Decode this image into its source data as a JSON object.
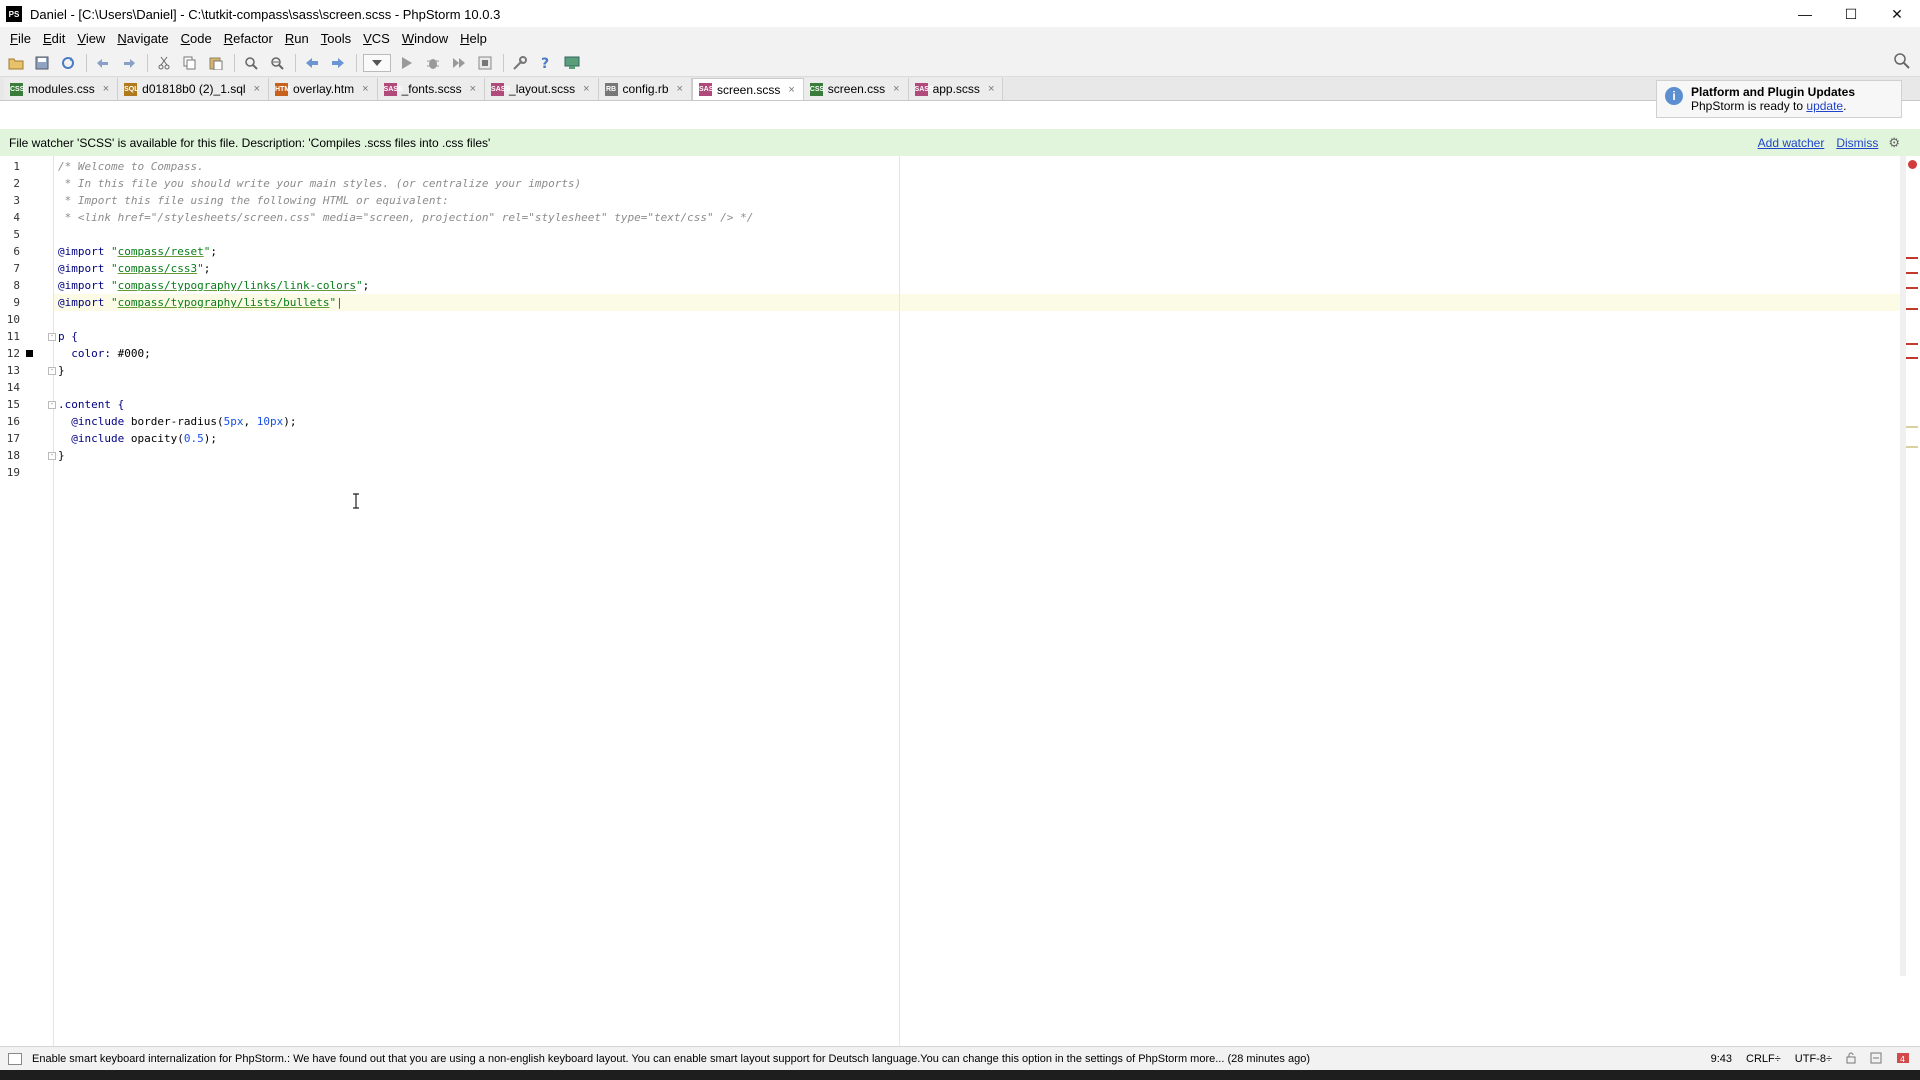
{
  "window": {
    "title": "Daniel - [C:\\Users\\Daniel] - C:\\tutkit-compass\\sass\\screen.scss - PhpStorm 10.0.3",
    "app_icon_text": "PS",
    "minimize_symbol": "—",
    "maximize_symbol": "☐",
    "close_symbol": "✕"
  },
  "menu": [
    {
      "label": "File",
      "mnemonic": "F",
      "rest": "ile"
    },
    {
      "label": "Edit",
      "mnemonic": "E",
      "rest": "dit"
    },
    {
      "label": "View",
      "mnemonic": "V",
      "rest": "iew"
    },
    {
      "label": "Navigate",
      "mnemonic": "N",
      "rest": "avigate"
    },
    {
      "label": "Code",
      "mnemonic": "C",
      "rest": "ode"
    },
    {
      "label": "Refactor",
      "mnemonic": "R",
      "rest": "efactor"
    },
    {
      "label": "Run",
      "mnemonic": "R",
      "rest": "un"
    },
    {
      "label": "Tools",
      "mnemonic": "T",
      "rest": "ools"
    },
    {
      "label": "VCS",
      "mnemonic": "V",
      "rest": "CS"
    },
    {
      "label": "Window",
      "mnemonic": "W",
      "rest": "indow"
    },
    {
      "label": "Help",
      "mnemonic": "H",
      "rest": "elp"
    }
  ],
  "toolbar": {
    "icons": [
      "open-folder-icon",
      "save-all-icon",
      "synchronize-icon",
      "undo-icon",
      "redo-icon",
      "cut-icon",
      "copy-icon",
      "paste-icon",
      "find-icon",
      "replace-icon",
      "back-icon",
      "forward-icon",
      "run-config-dropdown",
      "run-icon",
      "debug-icon",
      "coverage-icon",
      "stop-icon",
      "settings-icon",
      "help-icon",
      "ftp-icon"
    ],
    "search_icon": "search-icon"
  },
  "tabs": [
    {
      "label": "modules.css",
      "icon": "CSS",
      "color": "#3a7d3a",
      "active": false
    },
    {
      "label": "d01818b0 (2)_1.sql",
      "icon": "SQL",
      "color": "#b07a1c",
      "active": false
    },
    {
      "label": "overlay.htm",
      "icon": "HTM",
      "color": "#c7621d",
      "active": false
    },
    {
      "label": "_fonts.scss",
      "icon": "SASS",
      "color": "#b04a7a",
      "active": false
    },
    {
      "label": "_layout.scss",
      "icon": "SASS",
      "color": "#b04a7a",
      "active": false
    },
    {
      "label": "config.rb",
      "icon": "RB",
      "color": "#777777",
      "active": false
    },
    {
      "label": "screen.scss",
      "icon": "SASS",
      "color": "#b04a7a",
      "active": true
    },
    {
      "label": "screen.css",
      "icon": "CSS",
      "color": "#3a7d3a",
      "active": false
    },
    {
      "label": "app.scss",
      "icon": "SASS",
      "color": "#b04a7a",
      "active": false
    }
  ],
  "tab_close_symbol": "×",
  "notification": {
    "title": "Platform and Plugin Updates",
    "body_prefix": "PhpStorm is ready to ",
    "link": "update",
    "body_suffix": ".",
    "icon": "info-icon"
  },
  "banner": {
    "text": "File watcher 'SCSS' is available for this file. Description: 'Compiles .scss files into .css files'",
    "add_watcher": "Add watcher",
    "dismiss": "Dismiss",
    "gear": "⚙"
  },
  "editor": {
    "current_line": 9,
    "lines": [
      {
        "n": "1",
        "parts": [
          {
            "t": "/* Welcome to Compass.",
            "c": "comment"
          }
        ]
      },
      {
        "n": "2",
        "parts": [
          {
            "t": " * In this file you should write your main styles. (or centralize your imports)",
            "c": "comment"
          }
        ]
      },
      {
        "n": "3",
        "parts": [
          {
            "t": " * Import this file using the following HTML or equivalent:",
            "c": "comment"
          }
        ]
      },
      {
        "n": "4",
        "parts": [
          {
            "t": " * <link href=\"/stylesheets/screen.css\" media=\"screen, projection\" rel=\"stylesheet\" type=\"text/css\" /> */",
            "c": "comment"
          }
        ]
      },
      {
        "n": "5",
        "parts": []
      },
      {
        "n": "6",
        "parts": [
          {
            "t": "@import ",
            "c": "at-kw"
          },
          {
            "t": "\"",
            "c": "str"
          },
          {
            "t": "compass/reset",
            "c": "str-u"
          },
          {
            "t": "\"",
            "c": "str"
          },
          {
            "t": ";",
            "c": "punct"
          }
        ]
      },
      {
        "n": "7",
        "parts": [
          {
            "t": "@import ",
            "c": "at-kw"
          },
          {
            "t": "\"",
            "c": "str"
          },
          {
            "t": "compass/css3",
            "c": "str-u"
          },
          {
            "t": "\"",
            "c": "str"
          },
          {
            "t": ";",
            "c": "punct"
          }
        ]
      },
      {
        "n": "8",
        "parts": [
          {
            "t": "@import ",
            "c": "at-kw"
          },
          {
            "t": "\"",
            "c": "str"
          },
          {
            "t": "compass/typography/links/link-colors",
            "c": "str-u"
          },
          {
            "t": "\"",
            "c": "str"
          },
          {
            "t": ";",
            "c": "punct"
          }
        ]
      },
      {
        "n": "9",
        "parts": [
          {
            "t": "@import ",
            "c": "at-kw"
          },
          {
            "t": "\"",
            "c": "str"
          },
          {
            "t": "compass/typography/lists/bullets",
            "c": "str-u"
          },
          {
            "t": "\"|",
            "c": "str"
          }
        ]
      },
      {
        "n": "10",
        "parts": []
      },
      {
        "n": "11",
        "parts": [
          {
            "t": "p {",
            "c": "sel"
          }
        ]
      },
      {
        "n": "12",
        "parts": [
          {
            "t": "  color: ",
            "c": "sel"
          },
          {
            "t": "#000",
            "c": "punct"
          },
          {
            "t": ";",
            "c": "punct"
          }
        ]
      },
      {
        "n": "13",
        "parts": [
          {
            "t": "}",
            "c": "punct"
          }
        ]
      },
      {
        "n": "14",
        "parts": []
      },
      {
        "n": "15",
        "parts": [
          {
            "t": ".content {",
            "c": "sel"
          }
        ]
      },
      {
        "n": "16",
        "parts": [
          {
            "t": "  @include ",
            "c": "at-kw"
          },
          {
            "t": "border-radius(",
            "c": "punct"
          },
          {
            "t": "5px",
            "c": "num"
          },
          {
            "t": ", ",
            "c": "punct"
          },
          {
            "t": "10px",
            "c": "num"
          },
          {
            "t": ");",
            "c": "punct"
          }
        ]
      },
      {
        "n": "17",
        "parts": [
          {
            "t": "  @include ",
            "c": "at-kw"
          },
          {
            "t": "opacity(",
            "c": "punct"
          },
          {
            "t": "0.5",
            "c": "num"
          },
          {
            "t": ");",
            "c": "punct"
          }
        ]
      },
      {
        "n": "18",
        "parts": [
          {
            "t": "}",
            "c": "punct"
          }
        ]
      },
      {
        "n": "19",
        "parts": []
      }
    ],
    "fold_lines": [
      11,
      13,
      15,
      18
    ],
    "bookmark_line": 12
  },
  "status": {
    "message": "Enable smart keyboard internalization for PhpStorm.: We have found out that you are using a non-english keyboard layout. You can enable smart layout support for Deutsch language.You can change this option in the settings of PhpStorm more... (28 minutes ago)",
    "position": "9:43",
    "line_separator": "CRLF÷",
    "encoding": "UTF-8÷"
  }
}
